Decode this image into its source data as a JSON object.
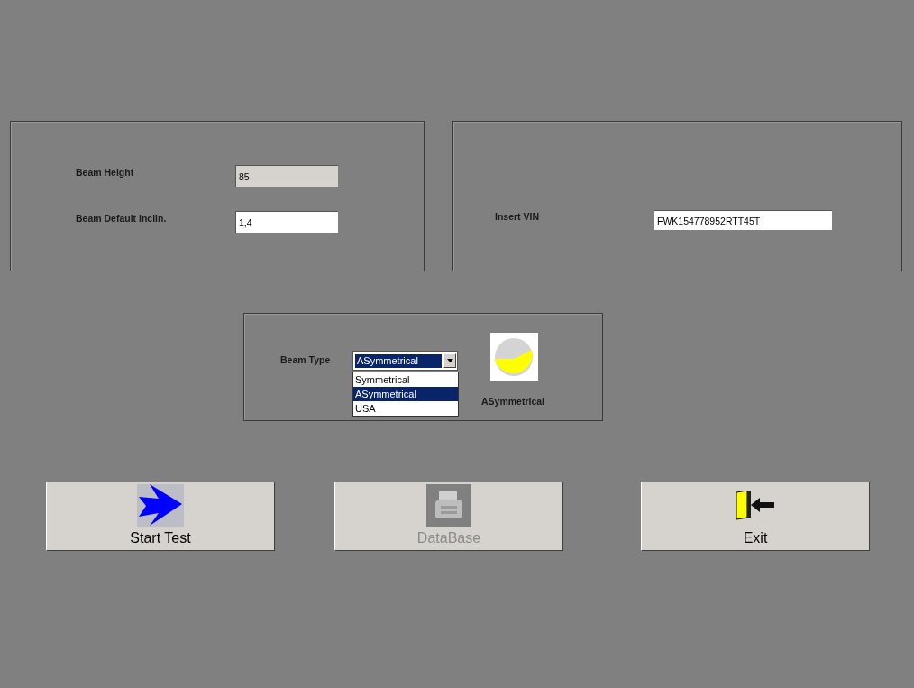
{
  "fields": [
    {
      "label": "Beam Height",
      "value": "85",
      "disabled": true
    },
    {
      "label": "Beam Default Inclin.",
      "value": "1,4",
      "disabled": false
    }
  ],
  "vin": {
    "label": "Insert VIN",
    "value": "FWK154778952RTT45T"
  },
  "beam_type": {
    "label": "Beam Type",
    "value": "ASymmetrical",
    "expanded": true,
    "options": [
      {
        "label": "Symmetrical",
        "selected": false
      },
      {
        "label": "ASymmetrical",
        "selected": true
      },
      {
        "label": "USA",
        "selected": false
      }
    ],
    "caption": "ASymmetrical"
  },
  "buttons": [
    {
      "kind": "start",
      "label": "Start Test",
      "disabled": false
    },
    {
      "kind": "database",
      "label": "DataBase",
      "disabled": true
    },
    {
      "kind": "exit",
      "label": "Exit",
      "disabled": false
    }
  ]
}
